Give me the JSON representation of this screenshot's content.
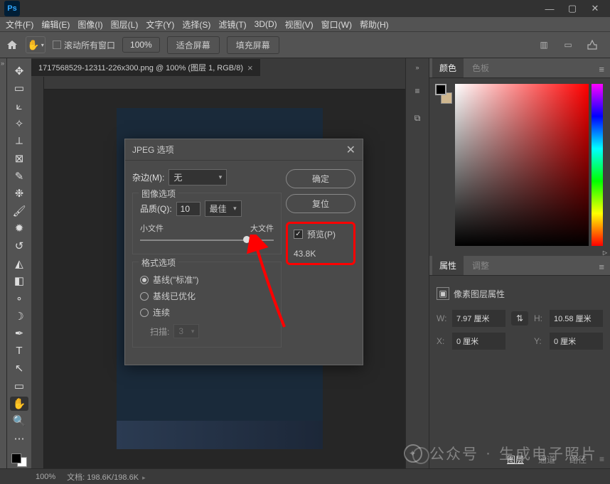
{
  "app": {
    "logo": "Ps"
  },
  "menu": [
    "文件(F)",
    "编辑(E)",
    "图像(I)",
    "图层(L)",
    "文字(Y)",
    "选择(S)",
    "滤镜(T)",
    "3D(D)",
    "视图(V)",
    "窗口(W)",
    "帮助(H)"
  ],
  "options": {
    "scroll_all": "滚动所有窗口",
    "zoom_value": "100%",
    "fit_screen": "适合屏幕",
    "fill_screen": "填充屏幕"
  },
  "doc_tab": {
    "title": "1717568529-12311-226x300.png @ 100% (图层 1, RGB/8)"
  },
  "panels": {
    "color_tab": "颜色",
    "swatch_tab": "色板",
    "prop_tab": "属性",
    "adjust_tab": "调整",
    "prop_desc": "像素图层属性",
    "w_label": "W:",
    "w_value": "7.97 厘米",
    "h_label": "H:",
    "h_value": "10.58 厘米",
    "x_label": "X:",
    "x_value": "0 厘米",
    "y_label": "Y:",
    "y_value": "0 厘米"
  },
  "bottom_tabs": {
    "layers": "图层",
    "channels": "通道",
    "paths": "路径"
  },
  "status": {
    "zoom": "100%",
    "doc": "文档:",
    "size": "198.6K/198.6K"
  },
  "dialog": {
    "title": "JPEG 选项",
    "matte_label": "杂边(M):",
    "matte_value": "无",
    "ok": "确定",
    "reset": "复位",
    "preview_label": "预览(P)",
    "file_size": "43.8K",
    "img_opts": "图像选项",
    "quality_label": "品质(Q):",
    "quality_value": "10",
    "quality_preset": "最佳",
    "small_file": "小文件",
    "large_file": "大文件",
    "format_opts": "格式选项",
    "fmt_baseline": "基线(\"标准\")",
    "fmt_optimized": "基线已优化",
    "fmt_progressive": "连续",
    "scans_label": "扫描:",
    "scans_value": "3"
  },
  "watermark": {
    "label_prefix": "公众号",
    "sep": "·",
    "label_suffix": "生成电子照片"
  }
}
